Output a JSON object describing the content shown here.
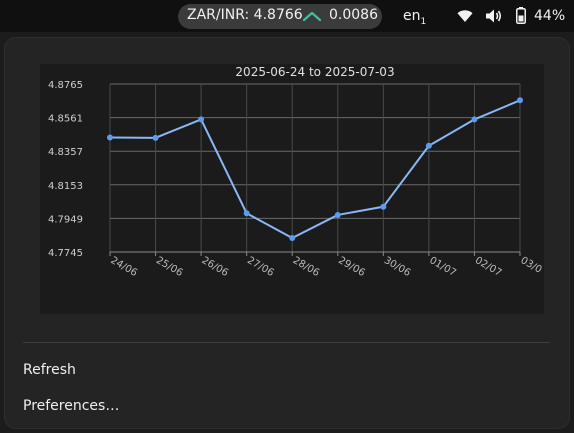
{
  "panel": {
    "indicator_label": "ZAR/INR: 4.8766",
    "indicator_change": "0.0086",
    "trend_icon": "chevron-up-icon",
    "trend_color": "#3fbf9f",
    "language": "en",
    "language_sub": "1",
    "wifi_icon": "wifi-icon",
    "volume_icon": "volume-icon",
    "battery_icon": "battery-icon",
    "battery_percent": "44%"
  },
  "chart_data": {
    "type": "line",
    "title": "2025-06-24 to 2025-07-03",
    "categories": [
      "24/06",
      "25/06",
      "26/06",
      "27/06",
      "28/06",
      "29/06",
      "30/06",
      "01/07",
      "02/07",
      "03/0"
    ],
    "series": [
      {
        "values": [
          4.844,
          4.8438,
          4.855,
          4.798,
          4.783,
          4.797,
          4.802,
          4.839,
          4.855,
          4.8666
        ]
      }
    ],
    "y_ticks": [
      "4.8765",
      "4.8561",
      "4.8357",
      "4.8153",
      "4.7949",
      "4.7745"
    ],
    "ylim": [
      4.7745,
      4.8765
    ],
    "grid": true,
    "line_color": "#8ab8f5",
    "point_color": "#5b9cf2"
  },
  "menu": {
    "refresh_label": "Refresh",
    "preferences_label": "Preferences…"
  }
}
